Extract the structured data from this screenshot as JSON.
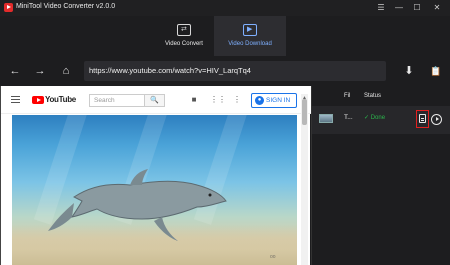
{
  "app": {
    "title": "MiniTool Video Converter v2.0.0"
  },
  "window_controls": {
    "menu": "☰",
    "minimize": "—",
    "maximize": "☐",
    "close": "✕"
  },
  "tabs": [
    {
      "label": "Video Convert",
      "icon": "convert-icon",
      "active": false
    },
    {
      "label": "Video Download",
      "icon": "download-icon",
      "active": true
    }
  ],
  "toolbar": {
    "back": "←",
    "forward": "→",
    "home": "⌂",
    "url": "https://www.youtube.com/watch?v=HIV_LarqTq4",
    "download": "⬇",
    "clipboard": "📋"
  },
  "youtube": {
    "brand": "YouTube",
    "search_placeholder": "Search",
    "search_button": "🔍",
    "camera": "■",
    "apps": "⋮⋮",
    "more": "⋮",
    "sign_in": "SIGN IN",
    "watermark": "oo"
  },
  "downloads": {
    "headers": {
      "file": "Fil",
      "status": "Status"
    },
    "rows": [
      {
        "file": "T...",
        "status": "✓ Done"
      }
    ]
  },
  "colors": {
    "accent": "#7fb0ff",
    "status_done": "#2bb54c",
    "highlight": "#e02020",
    "yt_red": "#ff0000"
  }
}
